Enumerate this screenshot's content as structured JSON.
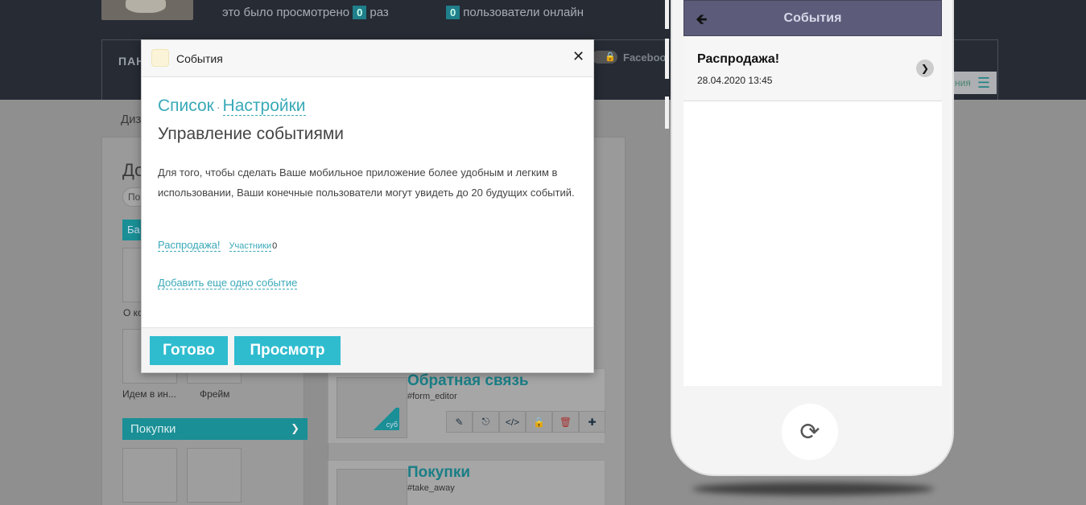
{
  "topbar": {
    "views_text": "это было просмотрено",
    "views_count": "0",
    "views_unit": "раз",
    "online_count": "0",
    "online_text": "пользователи онлайн"
  },
  "panel": {
    "title": "ПАН",
    "facebook_label": "Faceboo",
    "menu_label": "ния"
  },
  "background": {
    "tab_label": "Диз",
    "left_title": "До",
    "left_pill": "По",
    "left_teal": "Ба",
    "tiles": [
      {
        "caption": "О ко"
      },
      {
        "caption": "Идем в ин..."
      },
      {
        "caption": "Фрейм"
      }
    ],
    "category_bar": "Покупки",
    "cards": [
      {
        "title": "Обратная связь",
        "tag": "#form_editor",
        "badge": "суб"
      },
      {
        "title": "Покупки",
        "tag": "#take_away"
      }
    ]
  },
  "phone": {
    "header_title": "События",
    "event_name": "Распродажа!",
    "event_date": "28.04.2020 13:45"
  },
  "modal": {
    "header_title": "События",
    "crumb_list": "Список",
    "crumb_sep": "·",
    "crumb_settings": "Настройки",
    "heading": "Управление событиями",
    "description": "Для того, чтобы сделать Ваше мобильное приложение более удобным и легким в использовании, Ваши конечные пользователи могут увидеть до 20 будущих событий.",
    "event_link": "Распродажа!",
    "participants_label": "Участники",
    "participants_count": "0",
    "add_event": "Добавить еще одно событие",
    "done_button": "Готово",
    "preview_button": "Просмотр"
  },
  "colors": {
    "accent": "#2fbccf",
    "link": "#39a9b8",
    "topbar": "#262b34",
    "phone_header": "#5c5c7a"
  },
  "icons": [
    "close-icon",
    "back-arrow-icon",
    "chevron-right-icon",
    "refresh-icon",
    "pencil-icon",
    "link-icon",
    "code-icon",
    "lock-icon",
    "trash-icon",
    "move-icon",
    "chevron-down-icon",
    "menu-icon"
  ]
}
